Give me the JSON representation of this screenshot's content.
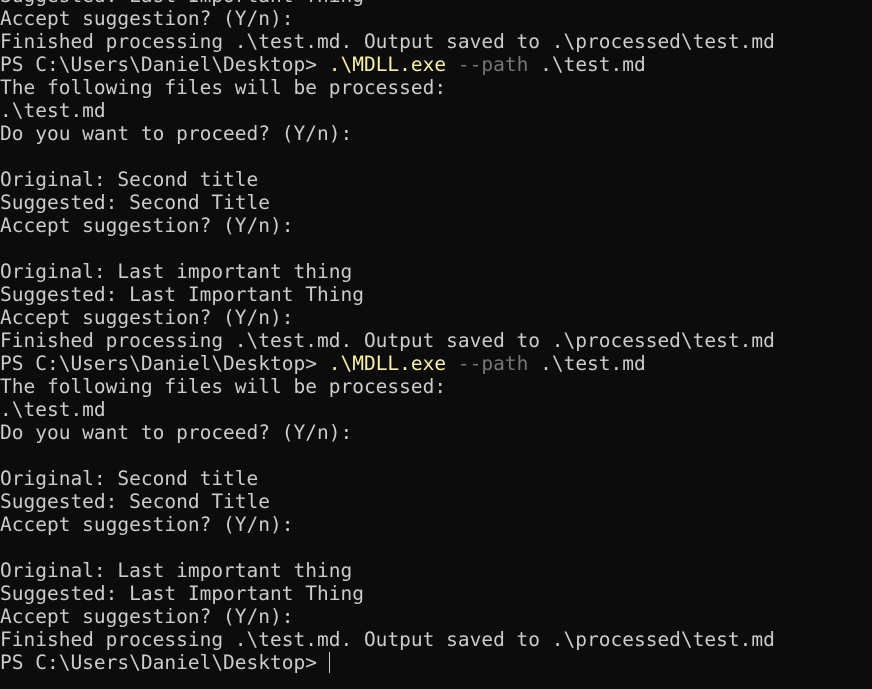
{
  "terminal": {
    "lines": [
      {
        "type": "text",
        "text": "Suggested: Last Important Thing"
      },
      {
        "type": "text",
        "text": "Accept suggestion? (Y/n):"
      },
      {
        "type": "text",
        "text": "Finished processing .\\test.md. Output saved to .\\processed\\test.md"
      },
      {
        "type": "command",
        "prompt": "PS C:\\Users\\Daniel\\Desktop> ",
        "exe": ".\\MDLL.exe",
        "param": "--path",
        "arg": ".\\test.md"
      },
      {
        "type": "text",
        "text": "The following files will be processed:"
      },
      {
        "type": "text",
        "text": ".\\test.md"
      },
      {
        "type": "text",
        "text": "Do you want to proceed? (Y/n):"
      },
      {
        "type": "text",
        "text": ""
      },
      {
        "type": "text",
        "text": "Original: Second title"
      },
      {
        "type": "text",
        "text": "Suggested: Second Title"
      },
      {
        "type": "text",
        "text": "Accept suggestion? (Y/n):"
      },
      {
        "type": "text",
        "text": ""
      },
      {
        "type": "text",
        "text": "Original: Last important thing"
      },
      {
        "type": "text",
        "text": "Suggested: Last Important Thing"
      },
      {
        "type": "text",
        "text": "Accept suggestion? (Y/n):"
      },
      {
        "type": "text",
        "text": "Finished processing .\\test.md. Output saved to .\\processed\\test.md"
      },
      {
        "type": "command",
        "prompt": "PS C:\\Users\\Daniel\\Desktop> ",
        "exe": ".\\MDLL.exe",
        "param": "--path",
        "arg": ".\\test.md"
      },
      {
        "type": "text",
        "text": "The following files will be processed:"
      },
      {
        "type": "text",
        "text": ".\\test.md"
      },
      {
        "type": "text",
        "text": "Do you want to proceed? (Y/n):"
      },
      {
        "type": "text",
        "text": ""
      },
      {
        "type": "text",
        "text": "Original: Second title"
      },
      {
        "type": "text",
        "text": "Suggested: Second Title"
      },
      {
        "type": "text",
        "text": "Accept suggestion? (Y/n):"
      },
      {
        "type": "text",
        "text": ""
      },
      {
        "type": "text",
        "text": "Original: Last important thing"
      },
      {
        "type": "text",
        "text": "Suggested: Last Important Thing"
      },
      {
        "type": "text",
        "text": "Accept suggestion? (Y/n):"
      },
      {
        "type": "text",
        "text": "Finished processing .\\test.md. Output saved to .\\processed\\test.md"
      },
      {
        "type": "prompt",
        "prompt": "PS C:\\Users\\Daniel\\Desktop> "
      }
    ]
  },
  "colors": {
    "background": "#0c0c0c",
    "foreground": "#cccccc",
    "command": "#f9f1a5",
    "parameter": "#767676"
  }
}
